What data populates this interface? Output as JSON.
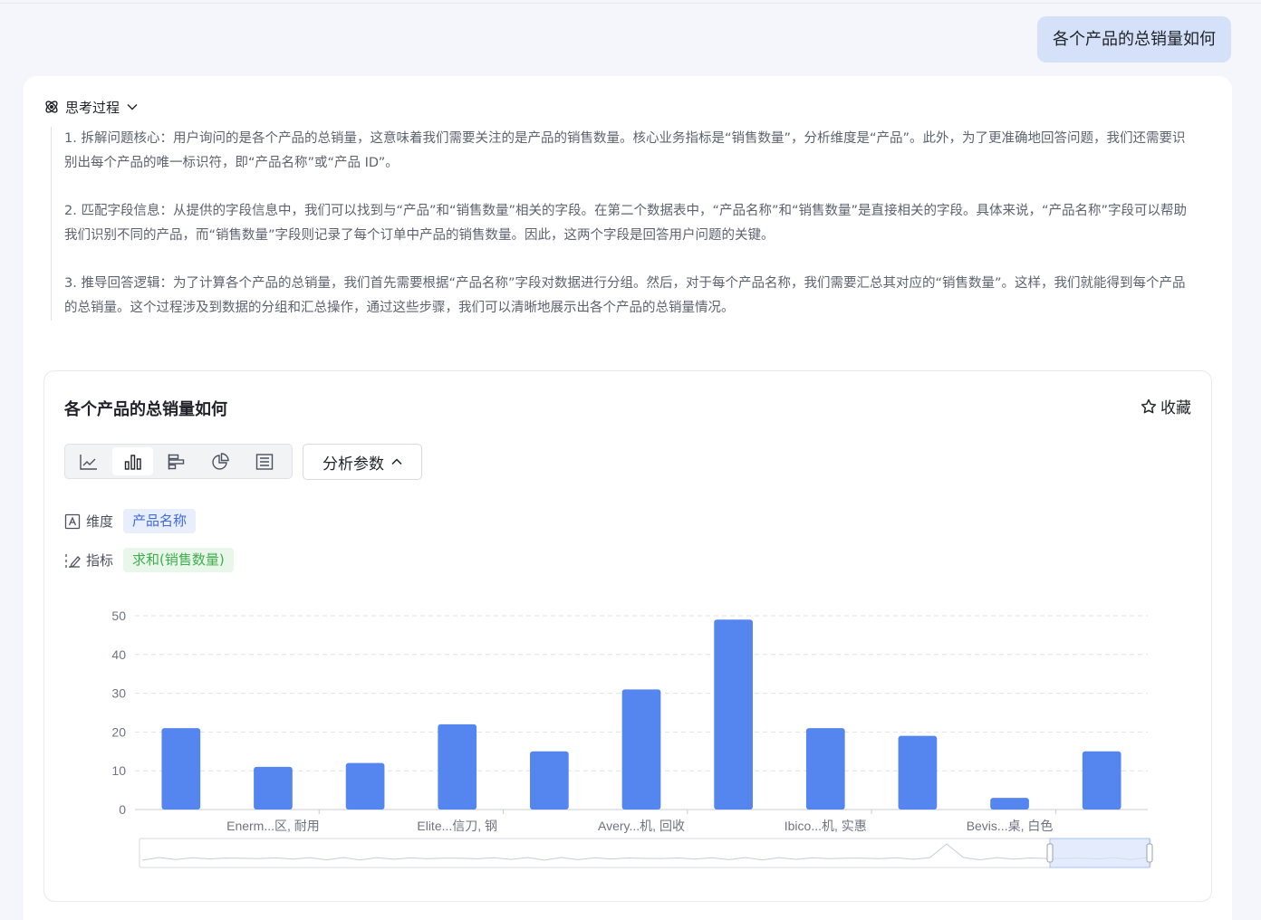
{
  "user_message": "各个产品的总销量如何",
  "thinking": {
    "label": "思考过程",
    "paragraphs": [
      "1. 拆解问题核心：用户询问的是各个产品的总销量，这意味着我们需要关注的是产品的销售数量。核心业务指标是“销售数量”，分析维度是“产品”。此外，为了更准确地回答问题，我们还需要识别出每个产品的唯一标识符，即“产品名称”或“产品 ID”。",
      "2. 匹配字段信息：从提供的字段信息中，我们可以找到与“产品”和“销售数量”相关的字段。在第二个数据表中，“产品名称”和“销售数量”是直接相关的字段。具体来说，“产品名称”字段可以帮助我们识别不同的产品，而“销售数量”字段则记录了每个订单中产品的销售数量。因此，这两个字段是回答用户问题的关键。",
      "3. 推导回答逻辑：为了计算各个产品的总销量，我们首先需要根据“产品名称”字段对数据进行分组。然后，对于每个产品名称，我们需要汇总其对应的“销售数量”。这样，我们就能得到每个产品的总销量。这个过程涉及到数据的分组和汇总操作，通过这些步骤，我们可以清晰地展示出各个产品的总销量情况。"
    ]
  },
  "chart_card": {
    "title": "各个产品的总销量如何",
    "favorite_label": "收藏",
    "params_label": "分析参数",
    "chart_types": [
      {
        "icon": "line-chart-icon",
        "active": false
      },
      {
        "icon": "bar-chart-icon",
        "active": true
      },
      {
        "icon": "horizontal-bar-chart-icon",
        "active": false
      },
      {
        "icon": "pie-chart-icon",
        "active": false
      },
      {
        "icon": "table-icon",
        "active": false
      }
    ],
    "dimension": {
      "label": "维度",
      "value": "产品名称"
    },
    "metric": {
      "label": "指标",
      "value": "求和(销售数量)"
    }
  },
  "chart_data": {
    "type": "bar",
    "color": "#5585ee",
    "categories": [
      "",
      "Enerm...区, 耐用",
      "",
      "Elite...信刀, 钢",
      "",
      "Avery...机, 回收",
      "",
      "Ibico...机, 实惠",
      "",
      "Bevis...桌, 白色",
      ""
    ],
    "values": [
      21,
      11,
      12,
      22,
      15,
      31,
      49,
      21,
      19,
      3,
      15
    ],
    "ylim": [
      0,
      50
    ],
    "yticks": [
      "0",
      "10",
      "20",
      "30",
      "40",
      "50"
    ],
    "grid": true,
    "zoom_slider": true
  }
}
